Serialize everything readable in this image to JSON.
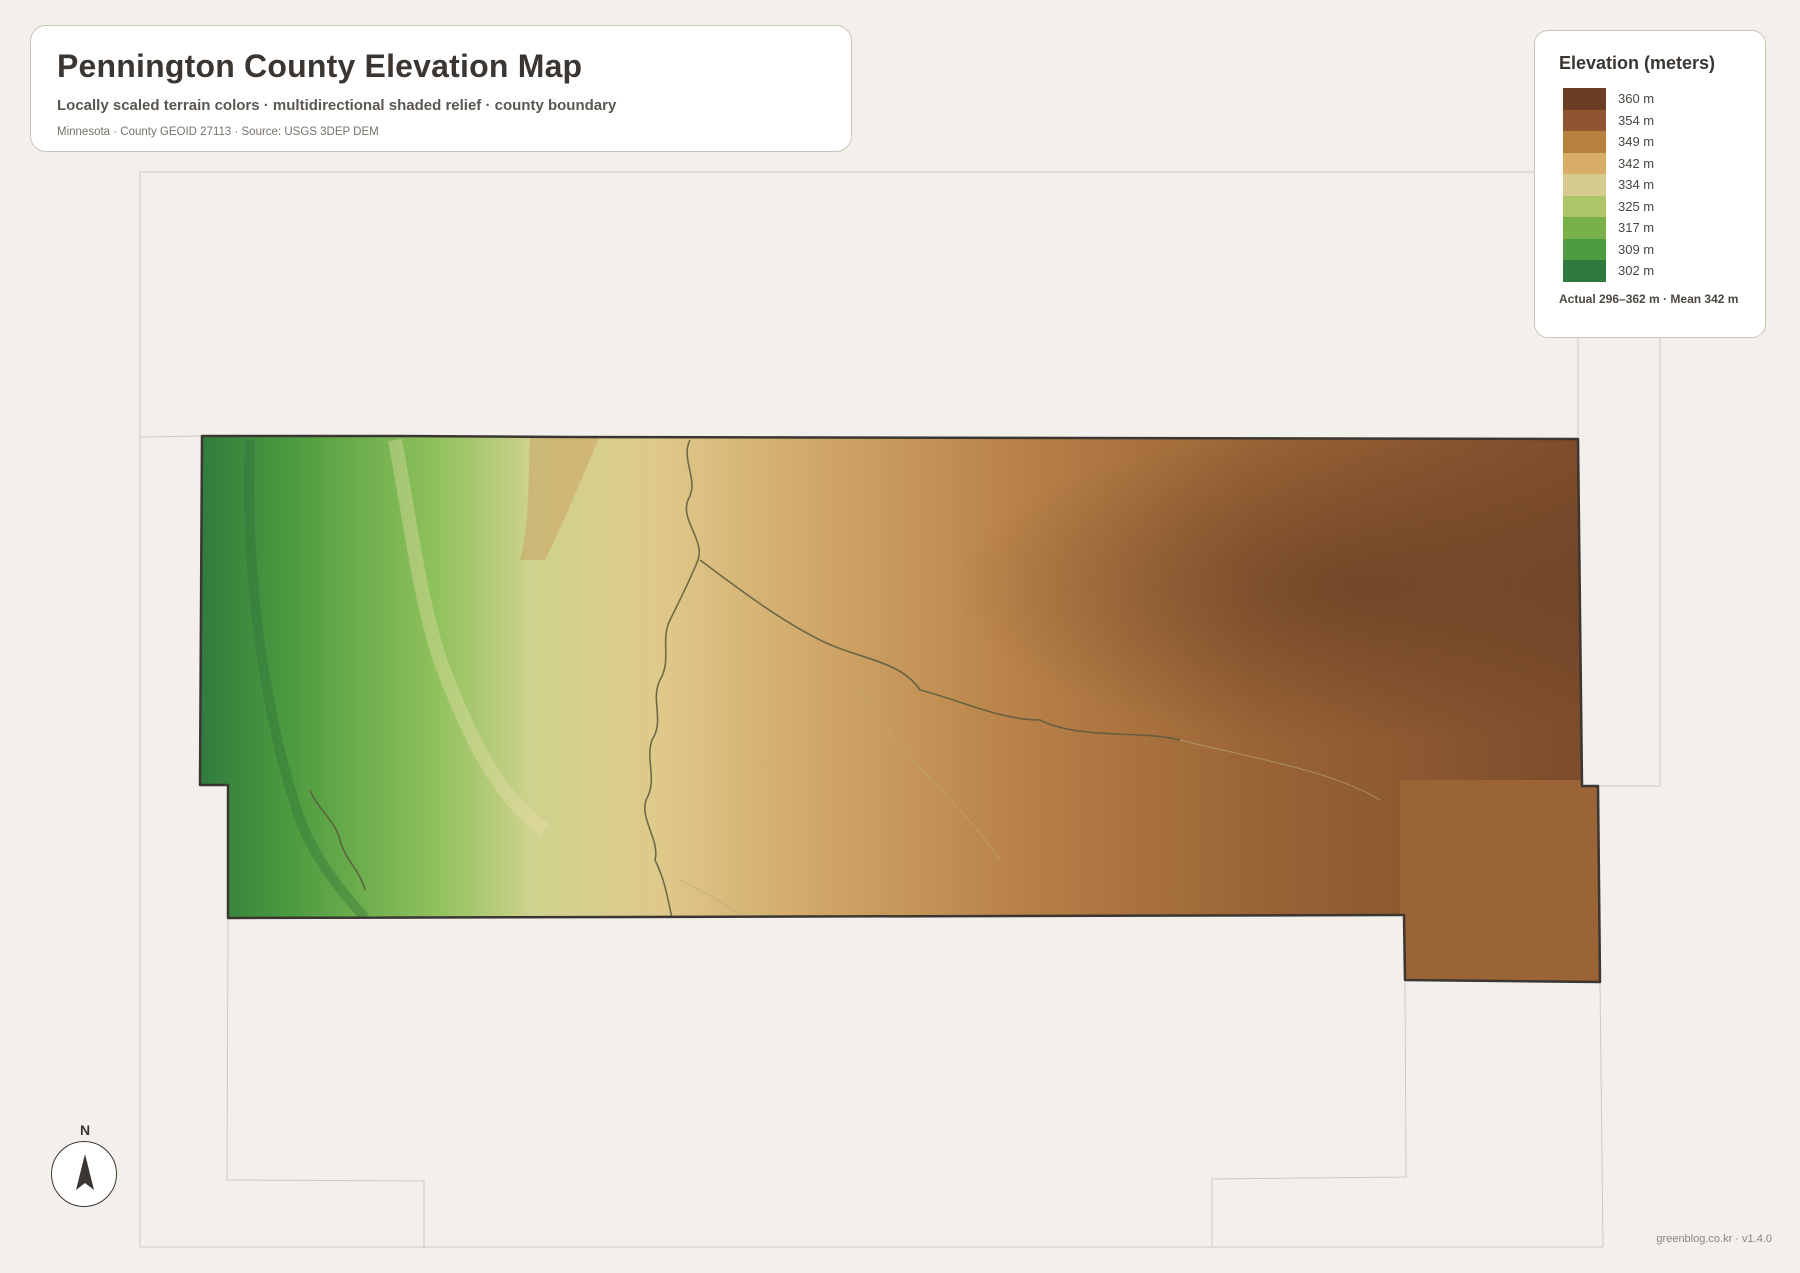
{
  "title_card": {
    "title": "Pennington County Elevation Map",
    "subtitle": "Locally scaled terrain colors · multidirectional shaded relief · county boundary",
    "meta": "Minnesota · County GEOID 27113 · Source: USGS 3DEP DEM"
  },
  "legend": {
    "title": "Elevation (meters)",
    "items": [
      {
        "label": "360 m",
        "color": "#6b3d24"
      },
      {
        "label": "354 m",
        "color": "#8e5530"
      },
      {
        "label": "349 m",
        "color": "#b8803f"
      },
      {
        "label": "342 m",
        "color": "#d7ad68"
      },
      {
        "label": "334 m",
        "color": "#d6ca8c"
      },
      {
        "label": "325 m",
        "color": "#adc468"
      },
      {
        "label": "317 m",
        "color": "#78b14a"
      },
      {
        "label": "309 m",
        "color": "#4e9c40"
      },
      {
        "label": "302 m",
        "color": "#2f7a3e"
      }
    ],
    "note": "Actual 296–362 m · Mean 342 m"
  },
  "compass": {
    "label": "N"
  },
  "credit": "greenblog.co.kr · v1.4.0",
  "colors": {
    "background": "#f3f0eb",
    "boundary": "#3b3631",
    "neighbor_lines": "#cfcac2",
    "low": "#2f7a3e",
    "mid": "#d6ca8c",
    "high": "#6b3d24"
  }
}
